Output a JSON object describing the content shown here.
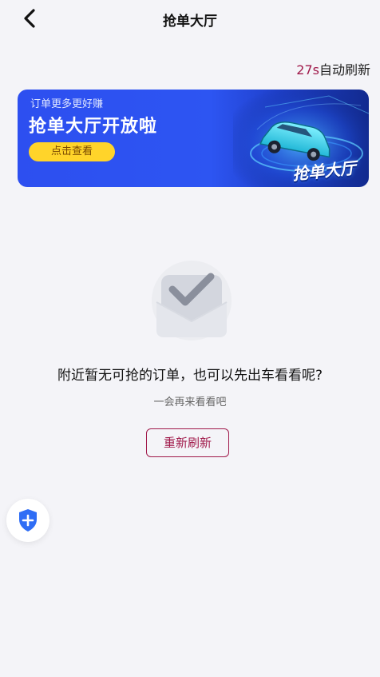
{
  "header": {
    "title": "抢单大厅",
    "back_icon": "chevron-left-icon"
  },
  "refresh_status": {
    "countdown": "27s",
    "label": "自动刷新"
  },
  "banner": {
    "subtitle": "订单更多更好赚",
    "title": "抢单大厅开放啦",
    "cta": "点击查看",
    "art_text": "抢单大厅"
  },
  "empty_state": {
    "icon": "empty-check-icon",
    "title": "附近暂无可抢的订单，也可以先出车看看呢?",
    "subtitle": "一会再来看看吧",
    "retry_label": "重新刷新"
  },
  "fab": {
    "icon": "shield-plus-icon"
  },
  "colors": {
    "accent": "#a0194a",
    "banner_blue": "#2d4ff0",
    "cta_yellow": "#ffd42a",
    "background": "#f4f4f8"
  }
}
